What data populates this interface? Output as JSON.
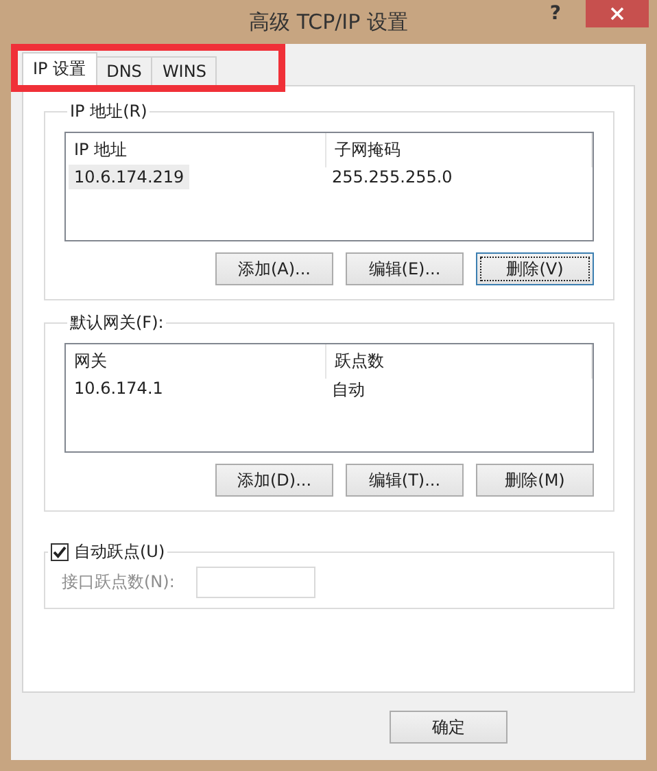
{
  "window": {
    "title": "高级 TCP/IP 设置",
    "help": "?"
  },
  "tabs": [
    {
      "label": "IP 设置",
      "selected": true
    },
    {
      "label": "DNS",
      "selected": false
    },
    {
      "label": "WINS",
      "selected": false
    }
  ],
  "ip_group": {
    "title": "IP 地址(R)",
    "columns": [
      "IP 地址",
      "子网掩码"
    ],
    "rows": [
      {
        "cells": [
          "10.6.174.219",
          "255.255.255.0"
        ],
        "selected": true
      }
    ],
    "buttons": [
      {
        "label": "添加(A)...",
        "focused": false
      },
      {
        "label": "编辑(E)...",
        "focused": false
      },
      {
        "label": "删除(V)",
        "focused": true
      }
    ]
  },
  "gateway_group": {
    "title": "默认网关(F):",
    "columns": [
      "网关",
      "跃点数"
    ],
    "rows": [
      {
        "cells": [
          "10.6.174.1",
          "自动"
        ],
        "selected": false
      }
    ],
    "buttons": [
      {
        "label": "添加(D)...",
        "focused": false
      },
      {
        "label": "编辑(T)...",
        "focused": false
      },
      {
        "label": "删除(M)",
        "focused": false
      }
    ]
  },
  "metric": {
    "checkbox": {
      "label": "自动跃点(U)",
      "checked": true
    },
    "field": {
      "label": "接口跃点数(N):",
      "disabled": true
    }
  },
  "footer": {
    "buttons": [
      {
        "label": "确定"
      }
    ]
  }
}
